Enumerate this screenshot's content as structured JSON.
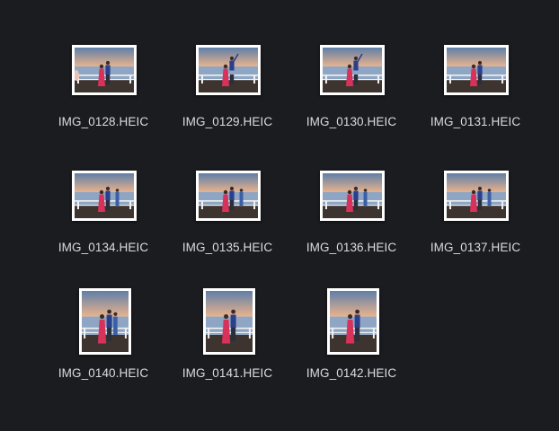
{
  "files": [
    {
      "name": "IMG_0128.HEIC",
      "orientation": "landscape",
      "pose": "a"
    },
    {
      "name": "IMG_0129.HEIC",
      "orientation": "landscape",
      "pose": "b"
    },
    {
      "name": "IMG_0130.HEIC",
      "orientation": "landscape",
      "pose": "b"
    },
    {
      "name": "IMG_0131.HEIC",
      "orientation": "landscape",
      "pose": "a"
    },
    {
      "name": "IMG_0134.HEIC",
      "orientation": "landscape",
      "pose": "c"
    },
    {
      "name": "IMG_0135.HEIC",
      "orientation": "landscape",
      "pose": "c"
    },
    {
      "name": "IMG_0136.HEIC",
      "orientation": "landscape",
      "pose": "c"
    },
    {
      "name": "IMG_0137.HEIC",
      "orientation": "landscape",
      "pose": "c"
    },
    {
      "name": "IMG_0140.HEIC",
      "orientation": "portrait",
      "pose": "c"
    },
    {
      "name": "IMG_0141.HEIC",
      "orientation": "portrait",
      "pose": "a"
    },
    {
      "name": "IMG_0142.HEIC",
      "orientation": "portrait",
      "pose": "a"
    }
  ],
  "colors": {
    "background": "#1b1c20",
    "label_text": "#dcdce0",
    "thumb_border": "#ffffff",
    "sky_top": "#5f7fa8",
    "sky_horizon": "#e9b38d",
    "water": "#8ea6c4",
    "pier": "#3d3430",
    "railing": "#f2f2f2",
    "dress": "#d8325a",
    "jacket": "#2c3f8a"
  }
}
